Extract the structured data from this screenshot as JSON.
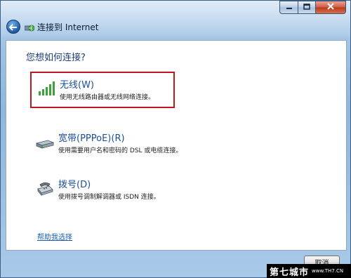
{
  "window": {
    "title": "连接到 Internet",
    "minimize_icon": "minimize-icon",
    "maximize_icon": "maximize-icon",
    "close_icon": "close-icon"
  },
  "main": {
    "question": "您想如何连接?",
    "options": [
      {
        "title": "无线(W)",
        "description": "使用无线路由器或无线网络连接。",
        "icon": "wireless-signal-icon",
        "selected": true
      },
      {
        "title": "宽带(PPPoE)(R)",
        "description": "使用需要用户名和密码的 DSL 或电缆连接。",
        "icon": "broadband-modem-icon",
        "selected": false
      },
      {
        "title": "拨号(D)",
        "description": "使用拨号调制解调器或 ISDN 连接。",
        "icon": "dialup-phone-icon",
        "selected": false
      }
    ],
    "help_link": "帮助我选择"
  },
  "footer": {
    "cancel_label": "取消"
  },
  "watermark": {
    "text": "第七城市",
    "url": "www.TH7.CN"
  },
  "colors": {
    "selection_border": "#c0171d",
    "option_title": "#1a4f9a",
    "question": "#1e3e74",
    "link": "#1a5fb4"
  }
}
